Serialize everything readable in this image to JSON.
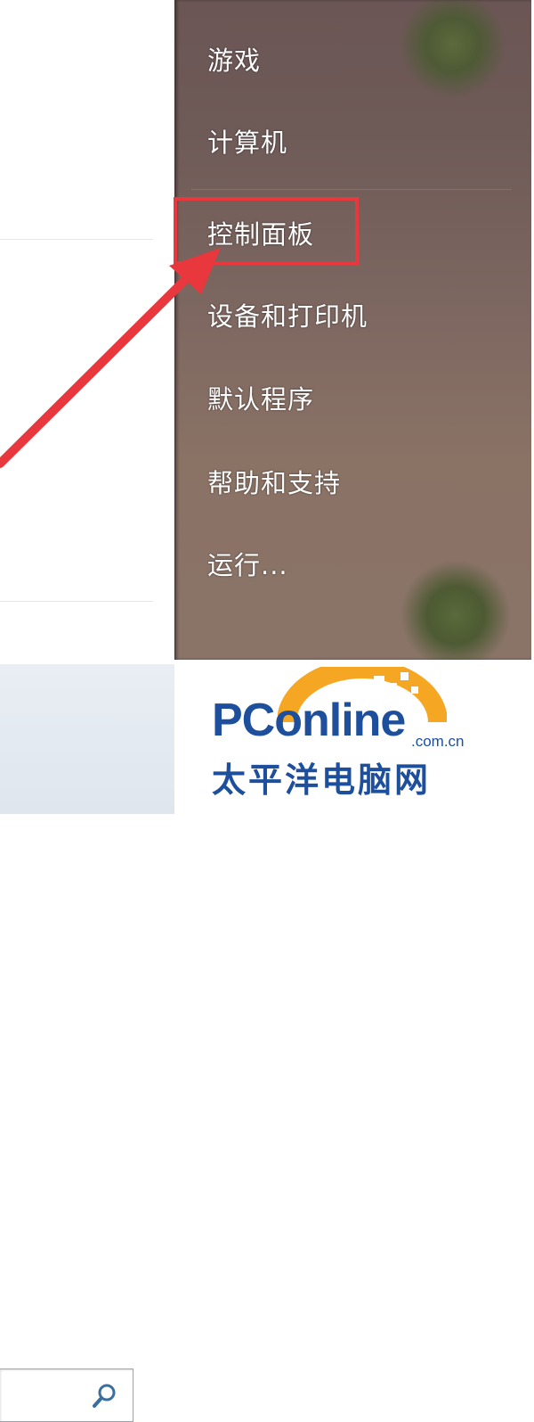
{
  "start_menu": {
    "right_items": [
      {
        "label": "游戏"
      },
      {
        "label": "计算机"
      },
      {
        "label": "控制面板"
      },
      {
        "label": "设备和打印机"
      },
      {
        "label": "默认程序"
      },
      {
        "label": "帮助和支持"
      },
      {
        "label": "运行..."
      }
    ],
    "highlighted_item": "控制面板"
  },
  "search": {
    "value": "",
    "placeholder": ""
  },
  "watermark": {
    "brand": "PConline",
    "domain": ".com.cn",
    "cn_name": "太平洋电脑网"
  },
  "colors": {
    "highlight_border": "#e8373d",
    "arrow": "#e8373d",
    "logo_blue": "#1d4f9c",
    "logo_orange": "#f5a623"
  }
}
